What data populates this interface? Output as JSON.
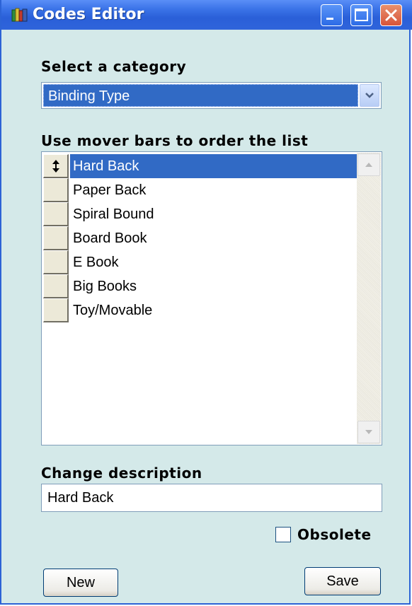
{
  "window": {
    "title": "Codes Editor"
  },
  "category": {
    "label": "Select a category",
    "selected": "Binding Type"
  },
  "list": {
    "label": "Use mover bars to order the list",
    "items": [
      {
        "label": "Hard Back",
        "selected": true
      },
      {
        "label": "Paper Back",
        "selected": false
      },
      {
        "label": "Spiral Bound",
        "selected": false
      },
      {
        "label": "Board Book",
        "selected": false
      },
      {
        "label": "E Book",
        "selected": false
      },
      {
        "label": "Big Books",
        "selected": false
      },
      {
        "label": "Toy/Movable",
        "selected": false
      }
    ]
  },
  "description": {
    "label": "Change description",
    "value": "Hard Back"
  },
  "obsolete": {
    "label": "Obsolete",
    "checked": false
  },
  "buttons": {
    "new_label": "New",
    "save_label": "Save"
  },
  "colors": {
    "selection": "#316ac5",
    "background": "#d4e9e9",
    "titlebar": "#2a5fd8"
  },
  "icons": {
    "app": "books-icon",
    "mover": "up-down-arrow-icon"
  }
}
